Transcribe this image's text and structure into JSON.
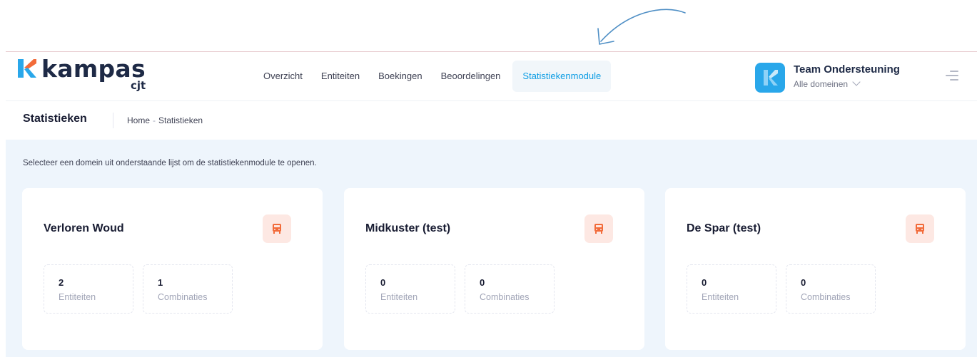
{
  "brand": {
    "name": "kampas",
    "sub": "cjt"
  },
  "nav": [
    {
      "label": "Overzicht",
      "active": false
    },
    {
      "label": "Entiteiten",
      "active": false
    },
    {
      "label": "Boekingen",
      "active": false
    },
    {
      "label": "Beoordelingen",
      "active": false
    },
    {
      "label": "Statistiekenmodule",
      "active": true
    }
  ],
  "user": {
    "name": "Team Ondersteuning",
    "domain": "Alle domeinen"
  },
  "page": {
    "title": "Statistieken",
    "breadcrumb": {
      "home": "Home",
      "separator": "-",
      "current": "Statistieken"
    },
    "intro": "Selecteer een domein uit onderstaande lijst om de statistiekenmodule te openen."
  },
  "domains": [
    {
      "title": "Verloren Woud",
      "stats": [
        {
          "value": "2",
          "label": "Entiteiten"
        },
        {
          "value": "1",
          "label": "Combinaties"
        }
      ]
    },
    {
      "title": "Midkuster (test)",
      "stats": [
        {
          "value": "0",
          "label": "Entiteiten"
        },
        {
          "value": "0",
          "label": "Combinaties"
        }
      ]
    },
    {
      "title": "De Spar (test)",
      "stats": [
        {
          "value": "0",
          "label": "Entiteiten"
        },
        {
          "value": "0",
          "label": "Combinaties"
        }
      ]
    }
  ],
  "colors": {
    "accent": "#0d9de4",
    "brand_blue": "#29a7ea",
    "brand_orange": "#f26b3a",
    "content_bg": "#eef5fc",
    "icon_bg": "#fde8e3"
  },
  "icons": {
    "card_icon": "bus-icon",
    "annotation": "arrow-icon"
  }
}
